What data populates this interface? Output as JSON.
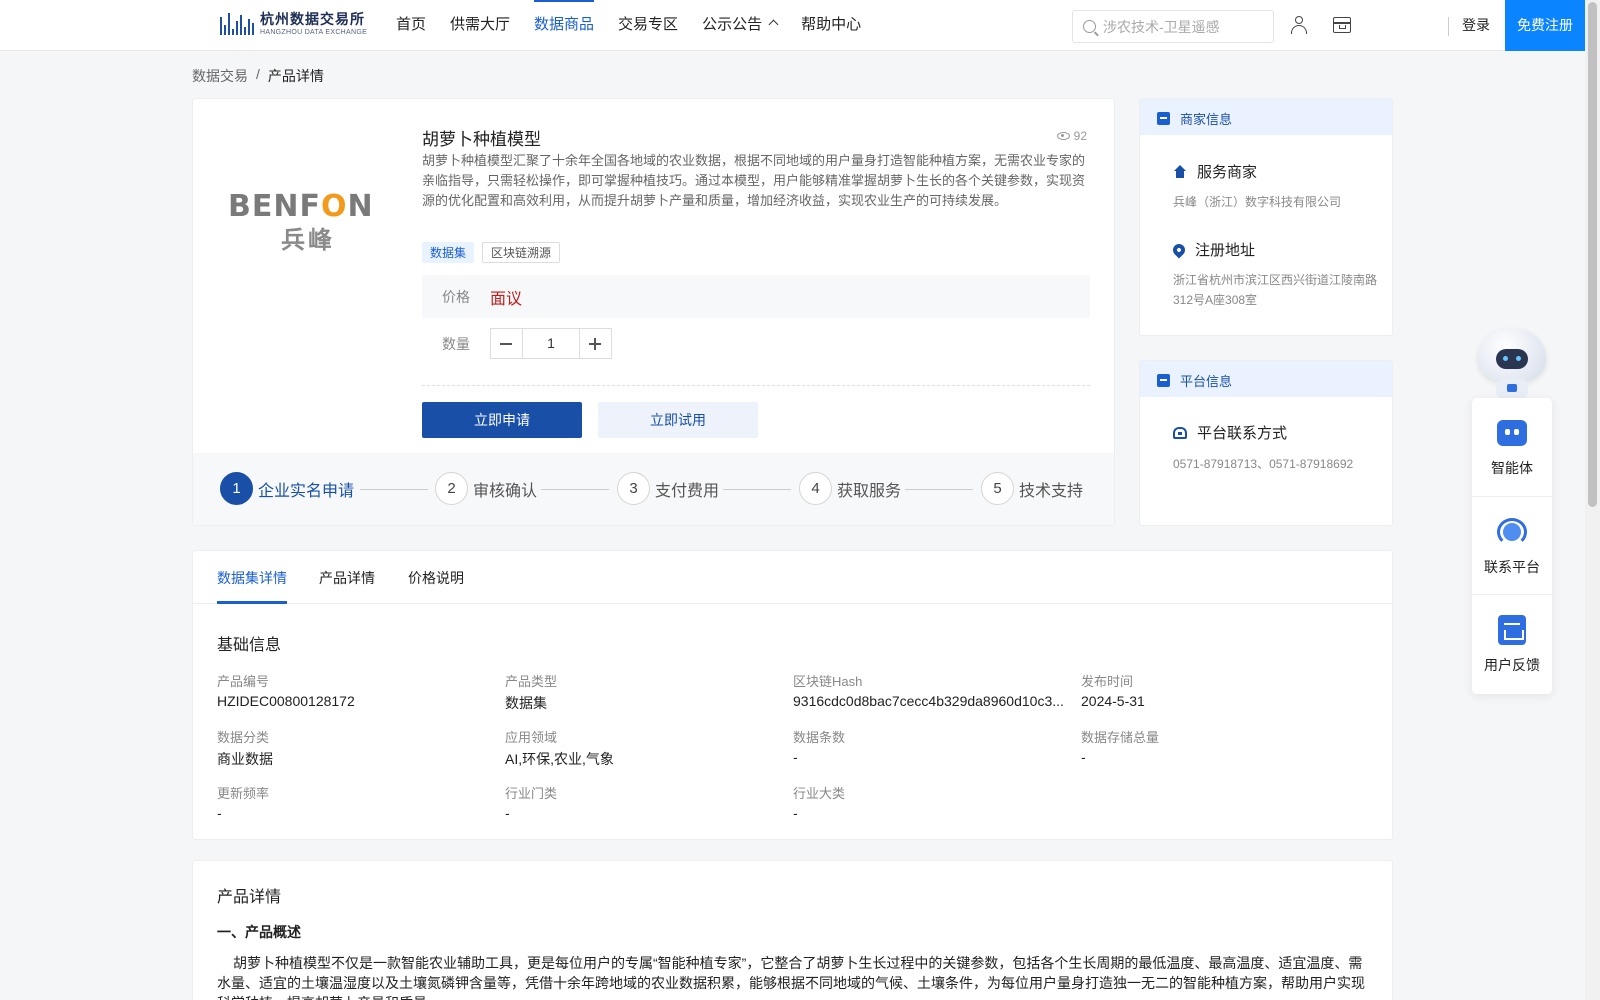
{
  "header": {
    "logo_cn": "杭州数据交易所",
    "logo_en": "HANGZHOU DATA EXCHANGE",
    "nav": [
      {
        "label": "首页"
      },
      {
        "label": "供需大厅"
      },
      {
        "label": "数据商品"
      },
      {
        "label": "交易专区"
      },
      {
        "label": "公示公告"
      },
      {
        "label": "帮助中心"
      }
    ],
    "active_nav": "数据商品",
    "search_placeholder": "涉农技术-卫星遥感",
    "login": "登录",
    "register": "免费注册"
  },
  "breadcrumb": {
    "root": "数据交易",
    "separator": "/",
    "current": "产品详情"
  },
  "product": {
    "logo_en_a": "BENF",
    "logo_en_o": "O",
    "logo_en_b": "N",
    "logo_cn": "兵峰",
    "title": "胡萝卜种植模型",
    "views": "92",
    "description": "胡萝卜种植模型汇聚了十余年全国各地域的农业数据，根据不同地域的用户量身打造智能种植方案，无需农业专家的亲临指导，只需轻松操作，即可掌握种植技巧。通过本模型，用户能够精准掌握胡萝卜生长的各个关键参数，实现资源的优化配置和高效利用，从而提升胡萝卜产量和质量，增加经济收益，实现农业生产的可持续发展。",
    "tags": [
      "数据集",
      "区块链溯源"
    ],
    "price_label": "价格",
    "price_value": "面议",
    "qty_label": "数量",
    "qty_value": "1",
    "apply_button": "立即申请",
    "trial_button": "立即试用",
    "steps": [
      {
        "num": "1",
        "label": "企业实名申请"
      },
      {
        "num": "2",
        "label": "审核确认"
      },
      {
        "num": "3",
        "label": "支付费用"
      },
      {
        "num": "4",
        "label": "获取服务"
      },
      {
        "num": "5",
        "label": "技术支持"
      }
    ]
  },
  "merchant": {
    "title": "商家信息",
    "service_title": "服务商家",
    "service_value": "兵峰（浙江）数字科技有限公司",
    "address_title": "注册地址",
    "address_value": "浙江省杭州市滨江区西兴街道江陵南路312号A座308室"
  },
  "platform": {
    "title": "平台信息",
    "contact_title": "平台联系方式",
    "contact_value": "0571-87918713、0571-87918692"
  },
  "float_panel": {
    "items": [
      "智能体",
      "联系平台",
      "用户反馈"
    ]
  },
  "tabs": [
    "数据集详情",
    "产品详情",
    "价格说明"
  ],
  "basic_info": {
    "title": "基础信息",
    "fields": [
      {
        "label": "产品编号",
        "value": "HZIDEC00800128172"
      },
      {
        "label": "产品类型",
        "value": "数据集"
      },
      {
        "label": "区块链Hash",
        "value": "9316cdc0d8bac7cecc4b329da8960d10c3..."
      },
      {
        "label": "发布时间",
        "value": "2024-5-31"
      },
      {
        "label": "数据分类",
        "value": "商业数据"
      },
      {
        "label": "应用领域",
        "value": "AI,环保,农业,气象"
      },
      {
        "label": "数据条数",
        "value": "-"
      },
      {
        "label": "数据存储总量",
        "value": "-"
      },
      {
        "label": "更新频率",
        "value": "-"
      },
      {
        "label": "行业门类",
        "value": "-"
      },
      {
        "label": "行业大类",
        "value": "-"
      }
    ]
  },
  "product_detail": {
    "title": "产品详情",
    "heading": "一、产品概述",
    "paragraph": "胡萝卜种植模型不仅是一款智能农业辅助工具，更是每位用户的专属“智能种植专家”，它整合了胡萝卜生长过程中的关键参数，包括各个生长周期的最低温度、最高温度、适宜温度、需水量、适宜的土壤温湿度以及土壤氮磷钾含量等，凭借十余年跨地域的农业数据积累，能够根据不同地域的气候、土壤条件，为每位用户量身打造独一无二的智能种植方案，帮助用户实现科学种植，提高胡萝卜产量和质量。"
  },
  "colors": {
    "primary": "#1a4fa8",
    "accent": "#1a5fd0",
    "register": "#0a84ff",
    "price": "#c41b1b"
  }
}
